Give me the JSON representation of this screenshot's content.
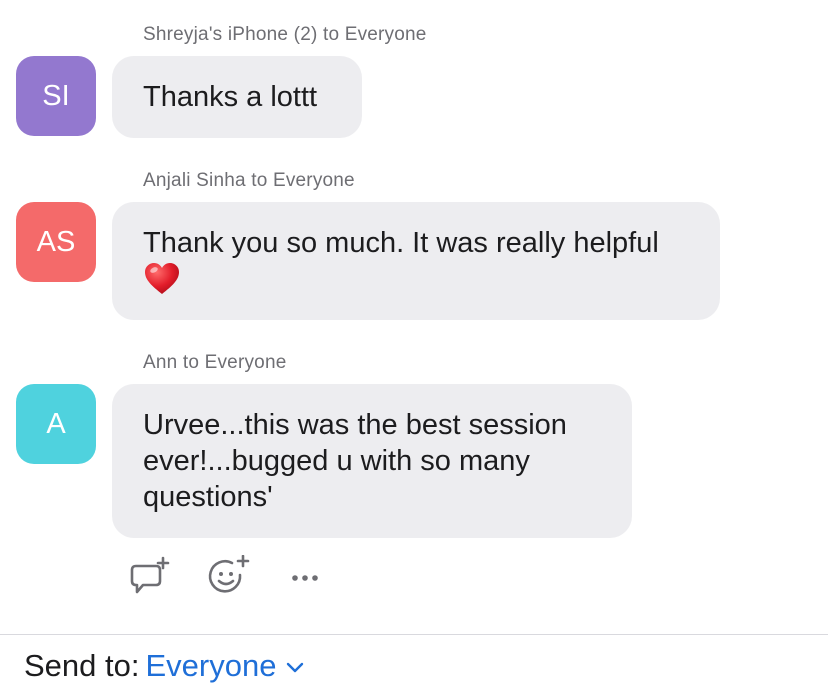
{
  "messages": [
    {
      "sender": "Shreyja's iPhone (2) to Everyone",
      "initials": "SI",
      "avatar_color": "#9378cf",
      "text": "Thanks a lottt",
      "emoji": ""
    },
    {
      "sender": "Anjali Sinha to Everyone",
      "initials": "AS",
      "avatar_color": "#f46a6a",
      "text": "Thank you so much. It was really helpful",
      "emoji": "❤️"
    },
    {
      "sender": "Ann to Everyone",
      "initials": "A",
      "avatar_color": "#4fd2de",
      "text": "Urvee...this was the best session ever!...bugged u with so many questions'",
      "emoji": ""
    }
  ],
  "message_actions": {
    "reply_icon": "reply-add-icon",
    "reaction_icon": "add-reaction-icon",
    "more_icon": "more-icon"
  },
  "footer": {
    "label": "Send to:",
    "target": "Everyone",
    "dropdown_icon": "chevron-down-icon",
    "accent": "#1f6fd8"
  }
}
